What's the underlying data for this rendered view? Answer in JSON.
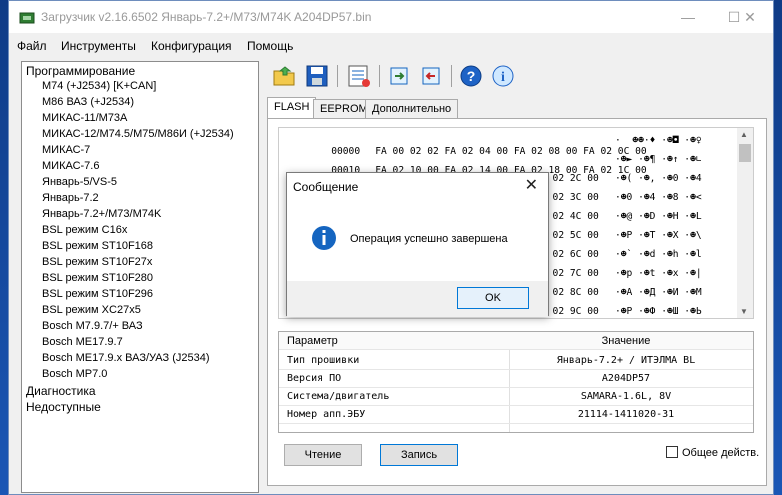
{
  "window": {
    "title": "Загрузчик v2.16.6502 Январь-7.2+/M73/M74K A204DP57.bin"
  },
  "menu": [
    "Файл",
    "Инструменты",
    "Конфигурация",
    "Помощь"
  ],
  "tree": {
    "items": [
      "Программирование",
      "M74 (+J2534) [K+CAN]",
      "M86 ВАЗ (+J2534)",
      "МИКАС-11/M73A",
      "МИКАС-12/M74.5/M75/M86И (+J2534)",
      "МИКАС-7",
      "МИКАС-7.6",
      "Январь-5/VS-5",
      "Январь-7.2",
      "Январь-7.2+/M73/M74K",
      "BSL режим C16x",
      "BSL режим ST10F168",
      "BSL режим ST10F27x",
      "BSL режим ST10F280",
      "BSL режим ST10F296",
      "BSL режим XC27x5",
      "Bosch M7.9.7/+ ВАЗ",
      "Bosch ME17.9.7",
      "Bosch ME17.9.x ВАЗ/УАЗ (J2534)",
      "Bosch MP7.0",
      "Диагностика",
      "Недоступные"
    ]
  },
  "toolbar": [
    "open-folder-icon",
    "save-disk-icon",
    "settings-list-icon",
    "read-chip-icon",
    "write-chip-icon",
    "help-icon",
    "info-icon"
  ],
  "tabs": [
    "FLASH",
    "EEPROM",
    "Дополнительно"
  ],
  "hex": {
    "lines": [
      {
        "addr": "00000",
        "bytes": "FA 00 02 02 FA 02 04 00 FA 02 08 00 FA 02 0C 00",
        "ascii": "·  ☻☻·♦ ·☻◘ ·☻♀"
      },
      {
        "addr": "00010",
        "bytes": "FA 02 10 00 FA 02 14 00 FA 02 18 00 FA 02 1C 00",
        "ascii": "·☻► ·☻¶ ·☻↑ ·☻∟"
      },
      {
        "addr": "",
        "bytes": "",
        "ascii": "·☻( ·☻, ·☻0 ·☻4"
      },
      {
        "addr": "",
        "bytes": "",
        "ascii": "·☻0 ·☻4 ·☻8 ·☻<"
      },
      {
        "addr": "",
        "bytes": "",
        "ascii": "·☻@ ·☻D ·☻H ·☻L"
      },
      {
        "addr": "",
        "bytes": "",
        "ascii": "·☻P ·☻T ·☻X ·☻\\"
      },
      {
        "addr": "",
        "bytes": "",
        "ascii": "·☻` ·☻d ·☻h ·☻l"
      },
      {
        "addr": "",
        "bytes": "",
        "ascii": "·☻p ·☻t ·☻x ·☻|"
      },
      {
        "addr": "",
        "bytes": "",
        "ascii": "·☻А ·☻Д ·☻И ·☻М"
      },
      {
        "addr": "",
        "bytes": "",
        "ascii": "·☻Р ·☻Ф ·☻Ш ·☻Ь"
      }
    ],
    "visible_ascii_col": [
      "2C 00",
      "3C 00",
      "4C 00",
      "5C 00",
      "6C 00",
      "7C 00",
      "8C 00",
      "9C 00",
      "AC 00"
    ],
    "visible_right_bytes": [
      "A 02 2C 00",
      "A 02 3C 00",
      "A 02 4C 00",
      "A 02 5C 00",
      "A 02 6C 00",
      "A 02 7C 00",
      "A 02 8C 00",
      "A 02 9C 00",
      "A 02 AC 00"
    ]
  },
  "params": {
    "header": {
      "key": "Параметр",
      "value": "Значение"
    },
    "rows": [
      {
        "key": "Тип прошивки",
        "value": "Январь-7.2+ / ИТЭЛМА BL"
      },
      {
        "key": "Версия ПО",
        "value": "A204DP57"
      },
      {
        "key": "Система/двигатель",
        "value": "SAMARA-1.6L, 8V"
      },
      {
        "key": "Номер апп.ЭБУ",
        "value": "21114-1411020-31"
      }
    ]
  },
  "buttons": {
    "read": "Чтение",
    "write": "Запись"
  },
  "checkbox": {
    "label": "Общее действ."
  },
  "dialog": {
    "title": "Сообщение",
    "message": "Операция успешно завершена",
    "ok": "OK"
  }
}
